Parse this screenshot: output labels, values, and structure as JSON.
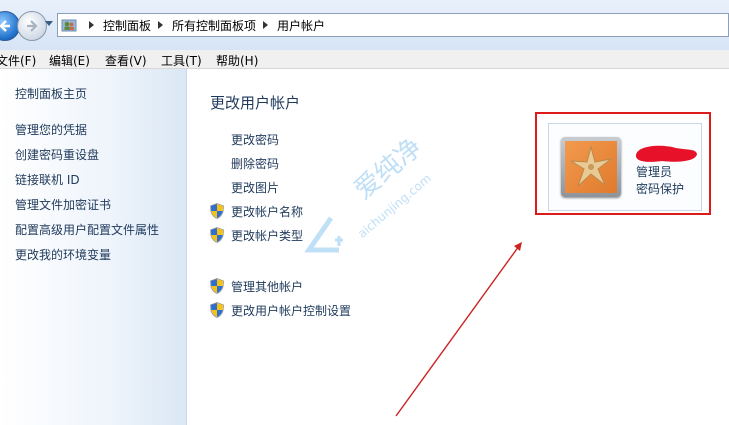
{
  "breadcrumb": [
    "控制面板",
    "所有控制面板项",
    "用户帐户"
  ],
  "menu": [
    "文件(F)",
    "编辑(E)",
    "查看(V)",
    "工具(T)",
    "帮助(H)"
  ],
  "sidebar": {
    "home": "控制面板主页",
    "links": [
      "管理您的凭据",
      "创建密码重设盘",
      "链接联机 ID",
      "管理文件加密证书",
      "配置高级用户配置文件属性",
      "更改我的环境变量"
    ]
  },
  "main": {
    "title": "更改用户帐户",
    "tasks": [
      "更改密码",
      "删除密码",
      "更改图片",
      "更改帐户名称",
      "更改帐户类型"
    ],
    "other_tasks": [
      "管理其他帐户",
      "更改用户帐户控制设置"
    ]
  },
  "account": {
    "type": "管理员",
    "status": "密码保护"
  },
  "watermark": {
    "text": "爱纯净",
    "url": "aichunjing.com"
  },
  "colors": {
    "link": "#1e395b",
    "highlight_box": "#dd1b1b",
    "redaction": "#e8112a",
    "annotation_arrow": "#cc2222"
  },
  "icons": {
    "nav_back": "back-arrow-icon",
    "nav_forward": "forward-arrow-icon",
    "location": "users-folder-icon",
    "uac": "uac-shield-icon",
    "avatar": "starfish-icon"
  }
}
